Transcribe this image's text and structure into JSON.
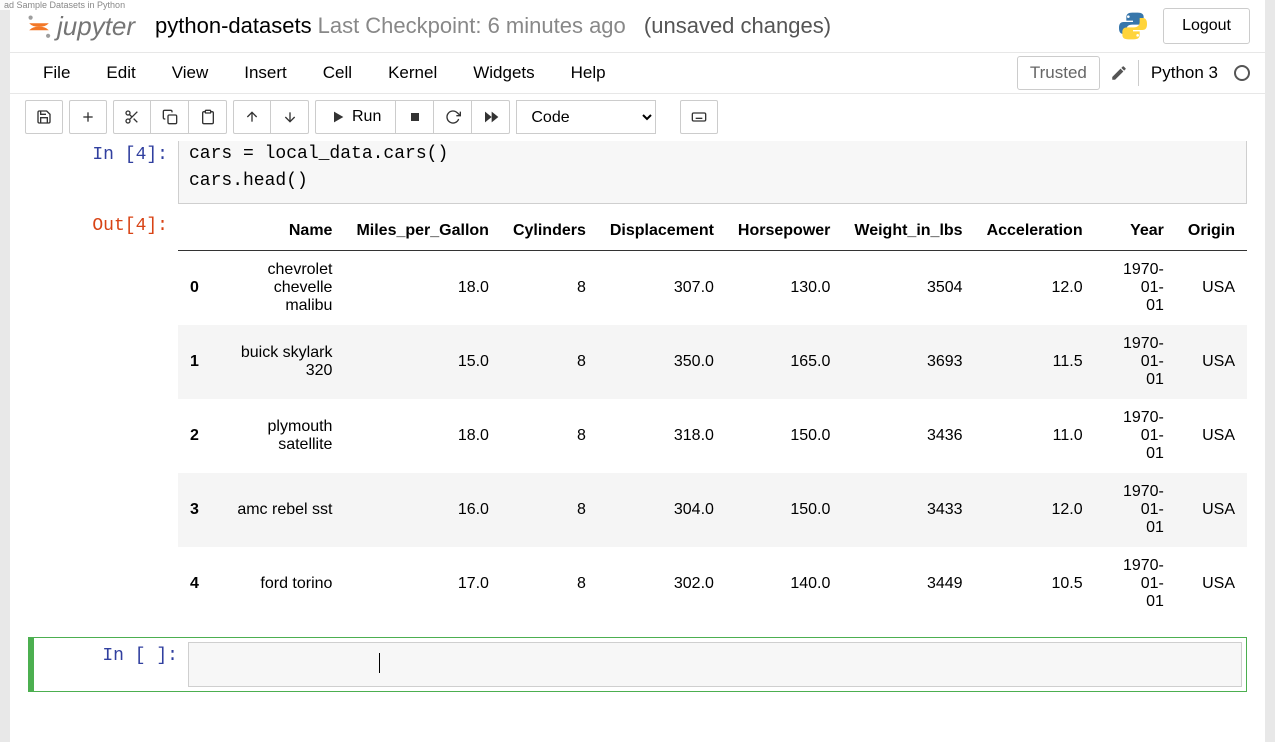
{
  "tab_caption": "ad Sample Datasets in Python",
  "header": {
    "logo_text": "jupyter",
    "notebook_name": "python-datasets",
    "checkpoint": "Last Checkpoint: 6 minutes ago",
    "unsaved": "(unsaved changes)",
    "logout": "Logout"
  },
  "menu": {
    "items": [
      "File",
      "Edit",
      "View",
      "Insert",
      "Cell",
      "Kernel",
      "Widgets",
      "Help"
    ],
    "trusted": "Trusted",
    "kernel": "Python 3"
  },
  "toolbar": {
    "run_label": "Run",
    "cell_type": "Code"
  },
  "cells": {
    "in4": {
      "prompt": "In [4]:",
      "code_line1": "cars = local_data.cars()",
      "code_line2": "cars.head()"
    },
    "out4": {
      "prompt": "Out[4]:",
      "columns": [
        "Name",
        "Miles_per_Gallon",
        "Cylinders",
        "Displacement",
        "Horsepower",
        "Weight_in_lbs",
        "Acceleration",
        "Year",
        "Origin"
      ],
      "rows": [
        {
          "idx": "0",
          "Name": "chevrolet chevelle malibu",
          "Miles_per_Gallon": "18.0",
          "Cylinders": "8",
          "Displacement": "307.0",
          "Horsepower": "130.0",
          "Weight_in_lbs": "3504",
          "Acceleration": "12.0",
          "Year": "1970-01-01",
          "Origin": "USA"
        },
        {
          "idx": "1",
          "Name": "buick skylark 320",
          "Miles_per_Gallon": "15.0",
          "Cylinders": "8",
          "Displacement": "350.0",
          "Horsepower": "165.0",
          "Weight_in_lbs": "3693",
          "Acceleration": "11.5",
          "Year": "1970-01-01",
          "Origin": "USA"
        },
        {
          "idx": "2",
          "Name": "plymouth satellite",
          "Miles_per_Gallon": "18.0",
          "Cylinders": "8",
          "Displacement": "318.0",
          "Horsepower": "150.0",
          "Weight_in_lbs": "3436",
          "Acceleration": "11.0",
          "Year": "1970-01-01",
          "Origin": "USA"
        },
        {
          "idx": "3",
          "Name": "amc rebel sst",
          "Miles_per_Gallon": "16.0",
          "Cylinders": "8",
          "Displacement": "304.0",
          "Horsepower": "150.0",
          "Weight_in_lbs": "3433",
          "Acceleration": "12.0",
          "Year": "1970-01-01",
          "Origin": "USA"
        },
        {
          "idx": "4",
          "Name": "ford torino",
          "Miles_per_Gallon": "17.0",
          "Cylinders": "8",
          "Displacement": "302.0",
          "Horsepower": "140.0",
          "Weight_in_lbs": "3449",
          "Acceleration": "10.5",
          "Year": "1970-01-01",
          "Origin": "USA"
        }
      ]
    },
    "in_empty": {
      "prompt": "In [ ]:"
    }
  }
}
